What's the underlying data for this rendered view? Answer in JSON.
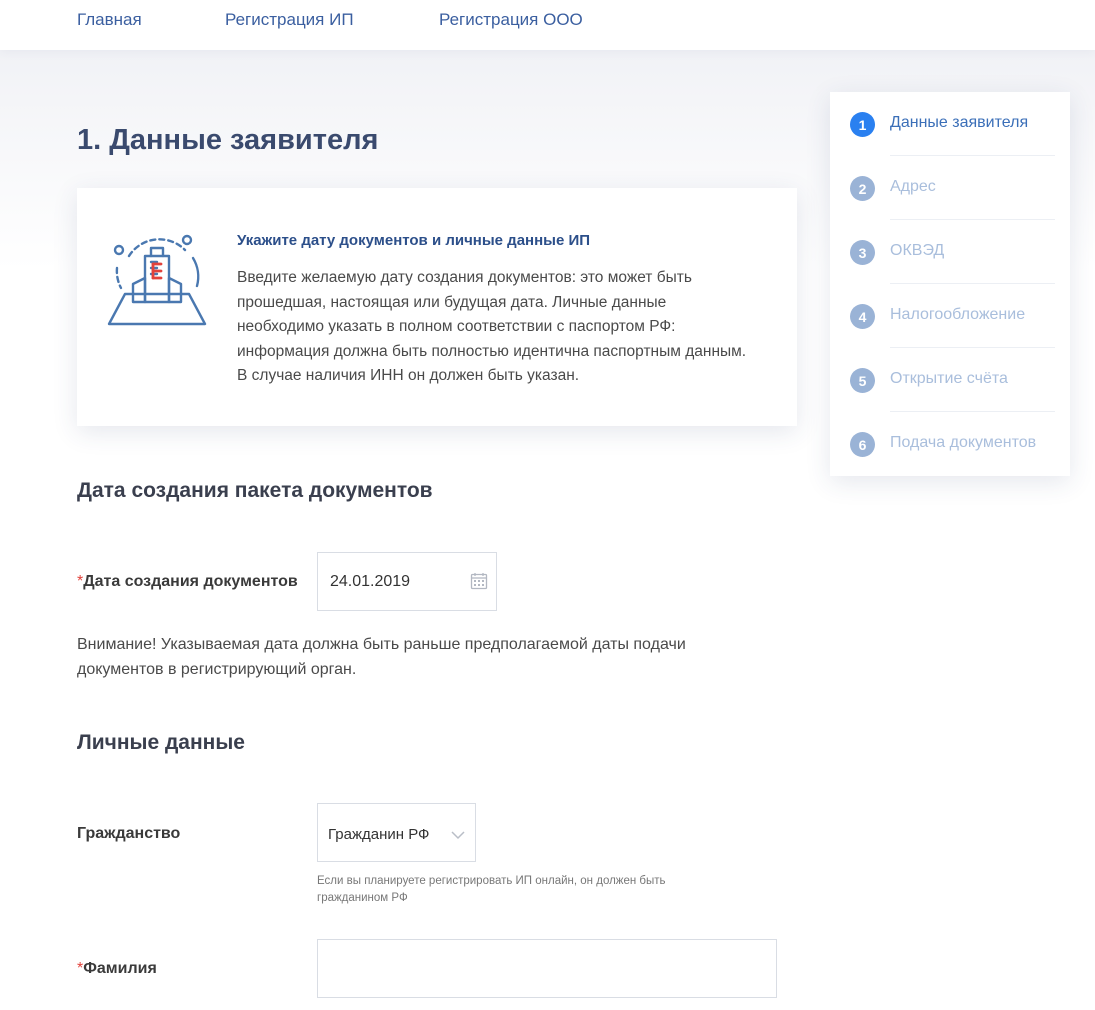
{
  "nav": {
    "home": "Главная",
    "ip": "Регистрация ИП",
    "ooo": "Регистрация ООО"
  },
  "page": {
    "title": "1. Данные заявителя"
  },
  "info": {
    "title": "Укажите дату документов и личные данные ИП",
    "text": "Введите желаемую дату создания документов: это может быть прошедшая, настоящая или будущая дата. Личные данные необходимо указать в полном соответствии с паспортом РФ: информация должна быть полностью идентична паспортным данным. В случае наличия ИНН он должен быть указан.",
    "icon": "building-icon"
  },
  "steps": [
    {
      "num": "1",
      "label": "Данные заявителя",
      "active": true
    },
    {
      "num": "2",
      "label": "Адрес",
      "active": false
    },
    {
      "num": "3",
      "label": "ОКВЭД",
      "active": false
    },
    {
      "num": "4",
      "label": "Налогообложение",
      "active": false
    },
    {
      "num": "5",
      "label": "Открытие счёта",
      "active": false
    },
    {
      "num": "6",
      "label": "Подача документов",
      "active": false
    }
  ],
  "date_section": {
    "title": "Дата создания пакета документов",
    "required_mark": "*",
    "label": "Дата создания документов",
    "value": "24.01.2019",
    "warning": "Внимание! Указываемая дата должна быть раньше предполагаемой даты подачи документов в регистрирующий орган."
  },
  "personal": {
    "title": "Личные данные",
    "citizenship": {
      "label": "Гражданство",
      "value": "Гражданин РФ",
      "hint": "Если вы планируете регистрировать ИП онлайн, он должен быть гражданином РФ"
    },
    "surname": {
      "required_mark": "*",
      "label": "Фамилия",
      "value": ""
    }
  },
  "colors": {
    "accent": "#2a80f0",
    "step_inactive": "#9ab3d6",
    "nav_link": "#3b5fa0",
    "required": "#e2423b",
    "icon_red": "#e2423b",
    "icon_blue": "#4a78b0"
  }
}
